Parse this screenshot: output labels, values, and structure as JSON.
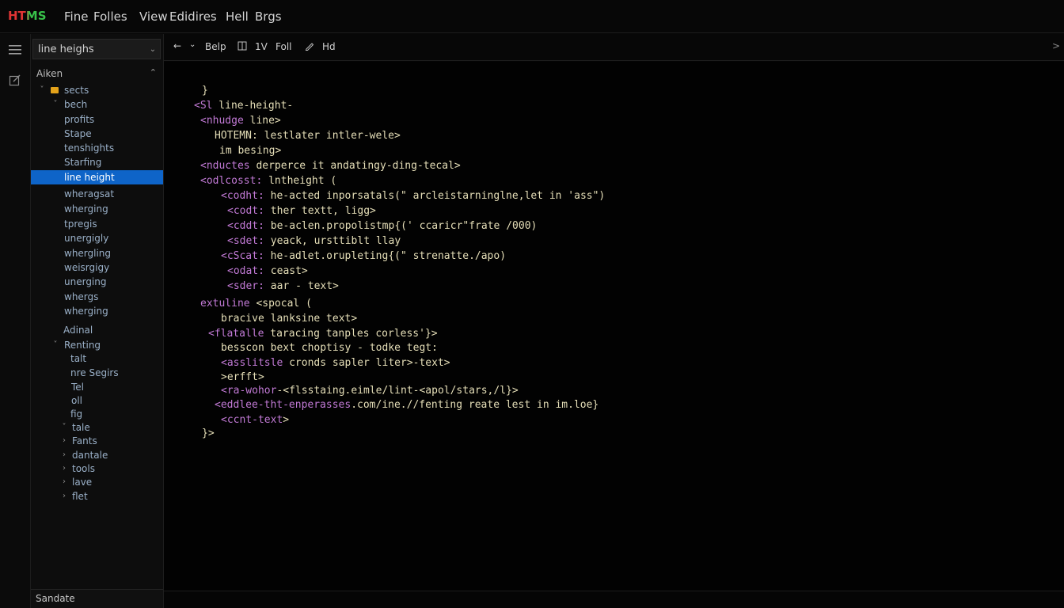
{
  "menubar": {
    "app_title": "HTMS",
    "items": [
      "Fine",
      "Folles",
      "View",
      "Edidires",
      "Hell",
      "Brgs"
    ]
  },
  "sidebar": {
    "search": {
      "value": "line heighs"
    },
    "section_title": "Aiken",
    "tree": [
      {
        "label": "sects",
        "twisty": "v",
        "folder": true
      },
      {
        "label": "bech",
        "twisty": "v"
      },
      {
        "label": "profits"
      },
      {
        "label": "Stape"
      },
      {
        "label": "tenshights"
      },
      {
        "label": "Starfing"
      },
      {
        "label": "line height",
        "selected": true
      },
      {
        "label": "wheragsat"
      },
      {
        "label": "wherging"
      },
      {
        "label": "tpregis"
      },
      {
        "label": "unergigly"
      },
      {
        "label": "whergling"
      },
      {
        "label": "weisrgigy"
      },
      {
        "label": "unerging"
      },
      {
        "label": "whergs"
      },
      {
        "label": "wherging"
      },
      {
        "label": "Adinal"
      },
      {
        "label": "Renting",
        "twisty": "v"
      },
      {
        "label": "talt"
      },
      {
        "label": "nre Segirs"
      },
      {
        "label": "Tel"
      },
      {
        "label": "oll"
      },
      {
        "label": "fig"
      },
      {
        "label": "tale",
        "twisty": "v"
      },
      {
        "label": "Fants",
        "twisty": ">"
      },
      {
        "label": "dantale",
        "twisty": ">"
      },
      {
        "label": "tools",
        "twisty": ">"
      },
      {
        "label": "lave",
        "twisty": ">"
      },
      {
        "label": "flet",
        "twisty": ">"
      }
    ],
    "footer_label": "Sandate"
  },
  "toolbar": {
    "items": [
      "Belp",
      "1V",
      "Foll",
      "Hd"
    ],
    "more_glyph": ">"
  },
  "editor": {
    "lines": [
      "}",
      "<Sl line-height-",
      "<nhudge line>",
      "HOTEMN: lestlater intler-wele>",
      "im besing>",
      "<nductes derperce it andatingy-ding-tecal>",
      "<odlcosst: lntheight (",
      "<codht: he-acted inporsatals(\" arcleistarninglne,let in 'ass\")",
      "<codt: ther textt, ligg>",
      "<cddt: be-aclen.propolistmp{(' ccaricr\"frate /000)",
      "<sdet: yeack, ursttiblt llay",
      "<cScat: he-adlet.orupleting{(\" strenatte./apo)",
      "<odat: ceast>",
      "<sder: aar - text>",
      "extuline <spocal (",
      "bracive lanksine text>",
      "<flatalle taracing tanples corless'}>",
      "besscon bext choptisy - todke tegt:",
      "<asslitsle cronds sapler liter>-text>",
      ">erfft>",
      "<ra-wohor-<flsstaing.eimle/lint-<apol/stars,/l}>",
      "<eddlee-tht-enperasses.com/ine.//fenting reate lest in im.loe}",
      "<ccnt-text>",
      "}>"
    ]
  },
  "colors": {
    "background": "#050505",
    "selection": "#0e64c8",
    "code_text": "#e6dfb8",
    "tag_color": "#c27ad6",
    "folder": "#e3a21a"
  }
}
